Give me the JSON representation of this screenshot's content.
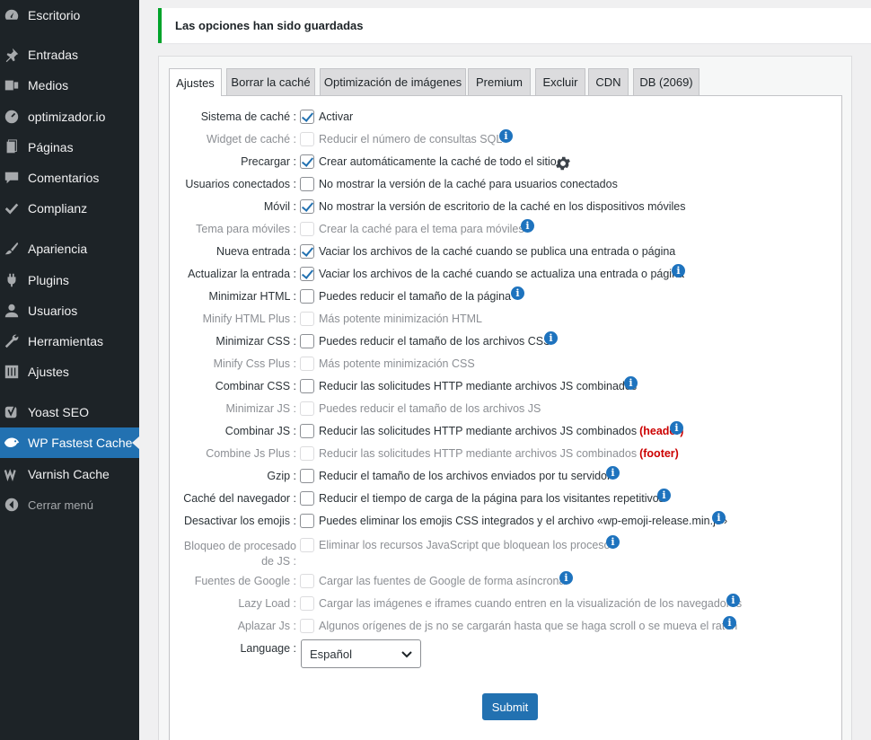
{
  "sidebar": {
    "items": [
      {
        "label": "Escritorio",
        "icon": "dashboard-icon"
      },
      {
        "label": "Entradas",
        "icon": "pin-icon"
      },
      {
        "label": "Medios",
        "icon": "media-icon"
      },
      {
        "label": "optimizador.io",
        "icon": "gauge-icon"
      },
      {
        "label": "Páginas",
        "icon": "pages-icon"
      },
      {
        "label": "Comentarios",
        "icon": "comment-icon"
      },
      {
        "label": "Complianz",
        "icon": "check-icon"
      },
      {
        "label": "Apariencia",
        "icon": "brush-icon"
      },
      {
        "label": "Plugins",
        "icon": "plugin-icon"
      },
      {
        "label": "Usuarios",
        "icon": "user-icon"
      },
      {
        "label": "Herramientas",
        "icon": "wrench-icon"
      },
      {
        "label": "Ajustes",
        "icon": "settings-icon"
      },
      {
        "label": "Yoast SEO",
        "icon": "yoast-icon"
      },
      {
        "label": "WP Fastest Cache",
        "icon": "cheetah-icon"
      },
      {
        "label": "Varnish Cache",
        "icon": "varnish-icon"
      },
      {
        "label": "Cerrar menú",
        "icon": "collapse-icon"
      }
    ]
  },
  "notice": {
    "text": "Las opciones han sido guardadas"
  },
  "tabs": [
    "Ajustes",
    "Borrar la caché",
    "Optimización de imágenes",
    "Premium",
    "Excluir",
    "CDN",
    "DB (2069)"
  ],
  "options": [
    {
      "label": "Sistema de caché :",
      "text": "Activar",
      "checked": true,
      "disabled": false
    },
    {
      "label": "Widget de caché :",
      "text": "Reducir el número de consultas SQL",
      "checked": false,
      "disabled": true
    },
    {
      "label": "Precargar :",
      "text": "Crear automáticamente la caché de todo el sitio",
      "checked": true,
      "disabled": false
    },
    {
      "label": "Usuarios conectados :",
      "text": "No mostrar la versión de la caché para usuarios conectados",
      "checked": false,
      "disabled": false
    },
    {
      "label": "Móvil :",
      "text": "No mostrar la versión de escritorio de la caché en los dispositivos móviles",
      "checked": true,
      "disabled": false
    },
    {
      "label": "Tema para móviles :",
      "text": "Crear la caché para el tema para móviles",
      "checked": false,
      "disabled": true
    },
    {
      "label": "Nueva entrada :",
      "text": "Vaciar los archivos de la caché cuando se publica una entrada o página",
      "checked": true,
      "disabled": false
    },
    {
      "label": "Actualizar la entrada :",
      "text": "Vaciar los archivos de la caché cuando se actualiza una entrada o página",
      "checked": true,
      "disabled": false
    },
    {
      "label": "Minimizar HTML :",
      "text": "Puedes reducir el tamaño de la página",
      "checked": false,
      "disabled": false
    },
    {
      "label": "Minify HTML Plus :",
      "text": "Más potente minimización HTML",
      "checked": false,
      "disabled": true
    },
    {
      "label": "Minimizar CSS :",
      "text": "Puedes reducir el tamaño de los archivos CSS",
      "checked": false,
      "disabled": false
    },
    {
      "label": "Minify Css Plus :",
      "text": "Más potente minimización CSS",
      "checked": false,
      "disabled": true
    },
    {
      "label": "Combinar CSS :",
      "text": "Reducir las solicitudes HTTP mediante archivos JS combinados",
      "checked": false,
      "disabled": false
    },
    {
      "label": "Minimizar JS :",
      "text": "Puedes reducir el tamaño de los archivos JS",
      "checked": false,
      "disabled": true
    },
    {
      "label": "Combinar JS :",
      "text": "Reducir las solicitudes HTTP mediante archivos JS combinados",
      "tag": "(header)",
      "checked": false,
      "disabled": false
    },
    {
      "label": "Combine Js Plus :",
      "text": "Reducir las solicitudes HTTP mediante archivos JS combinados",
      "tag": "(footer)",
      "checked": false,
      "disabled": true
    },
    {
      "label": "Gzip :",
      "text": "Reducir el tamaño de los archivos enviados por tu servidor",
      "checked": false,
      "disabled": false
    },
    {
      "label": "Caché del navegador :",
      "text": "Reducir el tiempo de carga de la página para los visitantes repetitivos",
      "checked": false,
      "disabled": false
    },
    {
      "label": "Desactivar los emojis :",
      "text": "Puedes eliminar los emojis CSS integrados y el archivo «wp-emoji-release.min.js»",
      "checked": false,
      "disabled": false
    },
    {
      "label": "Bloqueo de procesado de JS :",
      "text": "Eliminar los recursos JavaScript que bloquean los procesos",
      "checked": false,
      "disabled": true
    },
    {
      "label": "Fuentes de Google :",
      "text": "Cargar las fuentes de Google de forma asíncrona",
      "checked": false,
      "disabled": true
    },
    {
      "label": "Lazy Load :",
      "text": "Cargar las imágenes e iframes cuando entren en la visualización de los navegadores",
      "checked": false,
      "disabled": true
    },
    {
      "label": "Aplazar Js :",
      "text": "Algunos orígenes de js no se cargarán hasta que se haga scroll o se mueva el ratón",
      "checked": false,
      "disabled": true
    }
  ],
  "language": {
    "label": "Language :",
    "selected": "Español"
  },
  "submit_label": "Submit",
  "colors": {
    "sidebar": "#1d2327",
    "accent": "#2271b1",
    "notice_border": "#00a32a",
    "info": "#1e73be",
    "tag": "#cc0000"
  }
}
